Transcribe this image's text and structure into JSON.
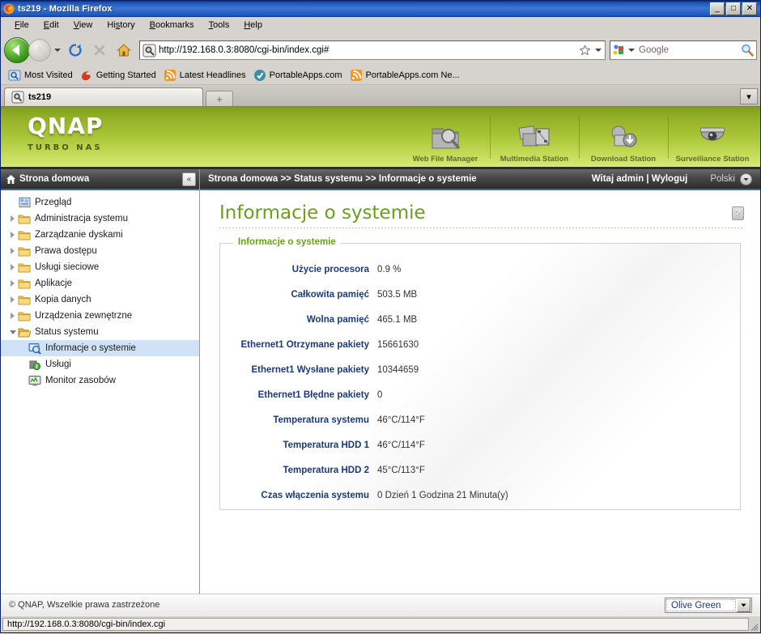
{
  "window": {
    "title": "ts219 - Mozilla Firefox",
    "icon": "firefox-icon",
    "minimize": "_",
    "maximize": "□",
    "close": "✕"
  },
  "menubar": [
    {
      "label": "File",
      "accesskey": "F"
    },
    {
      "label": "Edit",
      "accesskey": "E"
    },
    {
      "label": "View",
      "accesskey": "V"
    },
    {
      "label": "History",
      "accesskey": "s"
    },
    {
      "label": "Bookmarks",
      "accesskey": "B"
    },
    {
      "label": "Tools",
      "accesskey": "T"
    },
    {
      "label": "Help",
      "accesskey": "H"
    }
  ],
  "toolbar": {
    "back_icon": "back-arrow-icon",
    "forward_icon": "forward-arrow-icon",
    "reload_icon": "reload-icon",
    "stop_icon": "stop-icon",
    "home_icon": "home-icon",
    "url": "http://192.168.0.3:8080/cgi-bin/index.cgi#",
    "url_favicon": "site-identity-icon",
    "bookmark_star": "star-icon",
    "search_engine": "google-icon",
    "search_placeholder": "Google",
    "search_icon": "magnifier-icon"
  },
  "bookmarks": [
    {
      "label": "Most Visited",
      "icon": "most-visited-icon"
    },
    {
      "label": "Getting Started",
      "icon": "firefox-mascot-icon"
    },
    {
      "label": "Latest Headlines",
      "icon": "rss-feed-icon"
    },
    {
      "label": "PortableApps.com",
      "icon": "portableapps-icon"
    },
    {
      "label": "PortableApps.com Ne...",
      "icon": "rss-feed-icon"
    }
  ],
  "tabs": {
    "items": [
      {
        "label": "ts219",
        "favicon": "qnap-favicon",
        "active": true
      }
    ],
    "new_tab_label": "+",
    "list_all_tabs": "▾"
  },
  "banner": {
    "logo": "QNAP",
    "tagline": "TURBO NAS",
    "stations": [
      {
        "label": "Web File Manager",
        "icon": "folder-search-icon"
      },
      {
        "label": "Multimedia Station",
        "icon": "photos-film-icon"
      },
      {
        "label": "Download Station",
        "icon": "download-icon"
      },
      {
        "label": "Surveillance Station",
        "icon": "dome-camera-icon"
      }
    ]
  },
  "sidebar": {
    "header": {
      "label": "Strona domowa",
      "icon": "home-icon",
      "collapse": "«"
    },
    "items": [
      {
        "label": "Przegląd",
        "icon": "overview-icon",
        "level": 1,
        "twisty": "none",
        "selected": false
      },
      {
        "label": "Administracja systemu",
        "icon": "folder-icon",
        "level": 1,
        "twisty": "closed",
        "selected": false
      },
      {
        "label": "Zarządzanie dyskami",
        "icon": "folder-icon",
        "level": 1,
        "twisty": "closed",
        "selected": false
      },
      {
        "label": "Prawa dostępu",
        "icon": "folder-icon",
        "level": 1,
        "twisty": "closed",
        "selected": false
      },
      {
        "label": "Usługi sieciowe",
        "icon": "folder-icon",
        "level": 1,
        "twisty": "closed",
        "selected": false
      },
      {
        "label": "Aplikacje",
        "icon": "folder-icon",
        "level": 1,
        "twisty": "closed",
        "selected": false
      },
      {
        "label": "Kopia danych",
        "icon": "folder-icon",
        "level": 1,
        "twisty": "closed",
        "selected": false
      },
      {
        "label": "Urządzenia zewnętrzne",
        "icon": "folder-icon",
        "level": 1,
        "twisty": "closed",
        "selected": false
      },
      {
        "label": "Status systemu",
        "icon": "folder-open-icon",
        "level": 1,
        "twisty": "open",
        "selected": false
      },
      {
        "label": "Informacje o systemie",
        "icon": "system-info-icon",
        "level": 2,
        "twisty": "none",
        "selected": true
      },
      {
        "label": "Usługi",
        "icon": "services-icon",
        "level": 2,
        "twisty": "none",
        "selected": false
      },
      {
        "label": "Monitor zasobów",
        "icon": "resource-monitor-icon",
        "level": 2,
        "twisty": "none",
        "selected": false
      }
    ]
  },
  "breadcrumb": {
    "path": "Strona domowa >> Status systemu >> Informacje o systemie",
    "welcome": "Witaj admin | Wyloguj",
    "language": "Polski",
    "language_arrow": "chevron-down-icon"
  },
  "main": {
    "page_title": "Informacje o systemie",
    "help": "?",
    "panel_legend": "Informacje o systemie",
    "rows": [
      {
        "label": "Użycie procesora",
        "value": "0.9 %"
      },
      {
        "label": "Całkowita pamięć",
        "value": "503.5 MB"
      },
      {
        "label": "Wolna pamięć",
        "value": "465.1 MB"
      },
      {
        "label": "Ethernet1 Otrzymane pakiety",
        "value": "15661630"
      },
      {
        "label": "Ethernet1 Wysłane pakiety",
        "value": "10344659"
      },
      {
        "label": "Ethernet1 Błędne pakiety",
        "value": "0"
      },
      {
        "label": "Temperatura systemu",
        "value": "46°C/114°F"
      },
      {
        "label": "Temperatura HDD 1",
        "value": "46°C/114°F"
      },
      {
        "label": "Temperatura HDD 2",
        "value": "45°C/113°F"
      },
      {
        "label": "Czas włączenia systemu",
        "value": "0 Dzień 1 Godzina 21 Minuta(y)"
      }
    ]
  },
  "footer": {
    "copyright": "© QNAP, Wszelkie prawa zastrzeżone",
    "theme_selected": "Olive Green",
    "theme_arrow": "▾"
  },
  "statusbar": {
    "text": "http://192.168.0.3:8080/cgi-bin/index.cgi"
  },
  "colors": {
    "brand_green": "#8fae2c",
    "title_green": "#6a9f1d",
    "label_blue": "#1b3a7a",
    "selection_blue": "#cfe2f7",
    "titlebar_blue": "#1c4fb4"
  }
}
